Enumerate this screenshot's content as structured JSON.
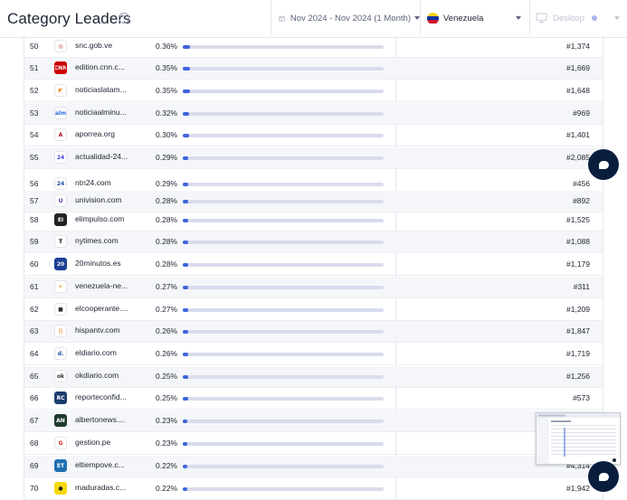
{
  "header": {
    "title": "Category Leaders",
    "info_icon": "info-icon",
    "date_range": "Nov 2024 - Nov 2024 (1 Month)",
    "country": "Venezuela",
    "device": "Desktop"
  },
  "colors": {
    "bar_fill": "#3e63dd",
    "bar_track": "#d9dced",
    "chat_bubble": "#0a1d3d",
    "flag_top": "#f7d117",
    "flag_mid": "#0033a0",
    "flag_bottom": "#cf142b"
  },
  "rows": [
    {
      "rank": "50",
      "domain": "snc.gob.ve",
      "share": "0.36%",
      "share_value": 0.36,
      "global_rank": "#1,374",
      "icon": "snc-icon"
    },
    {
      "rank": "51",
      "domain": "edition.cnn.c...",
      "share": "0.35%",
      "share_value": 0.35,
      "global_rank": "#1,669",
      "icon": "cnn-icon"
    },
    {
      "rank": "52",
      "domain": "noticiaslatam...",
      "share": "0.35%",
      "share_value": 0.35,
      "global_rank": "#1,648",
      "icon": "noticiaslatam-icon"
    },
    {
      "rank": "53",
      "domain": "noticiaalminu...",
      "share": "0.32%",
      "share_value": 0.32,
      "global_rank": "#969",
      "icon": "noticiaalminuto-icon"
    },
    {
      "rank": "54",
      "domain": "aporrea.org",
      "share": "0.30%",
      "share_value": 0.3,
      "global_rank": "#1,401",
      "icon": "aporrea-icon"
    },
    {
      "rank": "55",
      "domain": "actualidad-24...",
      "share": "0.29%",
      "share_value": 0.29,
      "global_rank": "#2,085",
      "icon": "actualidad24-icon"
    },
    {
      "rank": "56",
      "domain": "ntn24.com",
      "share": "0.29%",
      "share_value": 0.29,
      "global_rank": "#456",
      "icon": "ntn24-icon"
    },
    {
      "rank": "57",
      "domain": "univision.com",
      "share": "0.28%",
      "share_value": 0.28,
      "global_rank": "#892",
      "icon": "univision-icon"
    },
    {
      "rank": "58",
      "domain": "elimpulso.com",
      "share": "0.28%",
      "share_value": 0.28,
      "global_rank": "#1,525",
      "icon": "elimpulso-icon"
    },
    {
      "rank": "59",
      "domain": "nytimes.com",
      "share": "0.28%",
      "share_value": 0.28,
      "global_rank": "#1,088",
      "icon": "nytimes-icon"
    },
    {
      "rank": "60",
      "domain": "20minutos.es",
      "share": "0.28%",
      "share_value": 0.28,
      "global_rank": "#1,179",
      "icon": "20minutos-icon"
    },
    {
      "rank": "61",
      "domain": "venezuela-ne...",
      "share": "0.27%",
      "share_value": 0.27,
      "global_rank": "#311",
      "icon": "venezuela-news-icon"
    },
    {
      "rank": "62",
      "domain": "elcooperante....",
      "share": "0.27%",
      "share_value": 0.27,
      "global_rank": "#1,209",
      "icon": "elcooperante-icon"
    },
    {
      "rank": "63",
      "domain": "hispantv.com",
      "share": "0.26%",
      "share_value": 0.26,
      "global_rank": "#1,847",
      "icon": "hispantv-icon"
    },
    {
      "rank": "64",
      "domain": "eldiario.com",
      "share": "0.26%",
      "share_value": 0.26,
      "global_rank": "#1,719",
      "icon": "eldiario-icon"
    },
    {
      "rank": "65",
      "domain": "okdiario.com",
      "share": "0.25%",
      "share_value": 0.25,
      "global_rank": "#1,256",
      "icon": "okdiario-icon"
    },
    {
      "rank": "66",
      "domain": "reporteconfid...",
      "share": "0.25%",
      "share_value": 0.25,
      "global_rank": "#573",
      "icon": "reporteconfidencial-icon"
    },
    {
      "rank": "67",
      "domain": "albertonews....",
      "share": "0.23%",
      "share_value": 0.23,
      "global_rank": "",
      "icon": "albertonews-icon"
    },
    {
      "rank": "68",
      "domain": "gestion.pe",
      "share": "0.23%",
      "share_value": 0.23,
      "global_rank": "",
      "icon": "gestion-icon"
    },
    {
      "rank": "69",
      "domain": "eltiempove.c...",
      "share": "0.22%",
      "share_value": 0.22,
      "global_rank": "#4,314",
      "icon": "eltiempove-icon"
    },
    {
      "rank": "70",
      "domain": "maduradas.c...",
      "share": "0.22%",
      "share_value": 0.22,
      "global_rank": "#1,942",
      "icon": "maduradas-icon"
    }
  ]
}
